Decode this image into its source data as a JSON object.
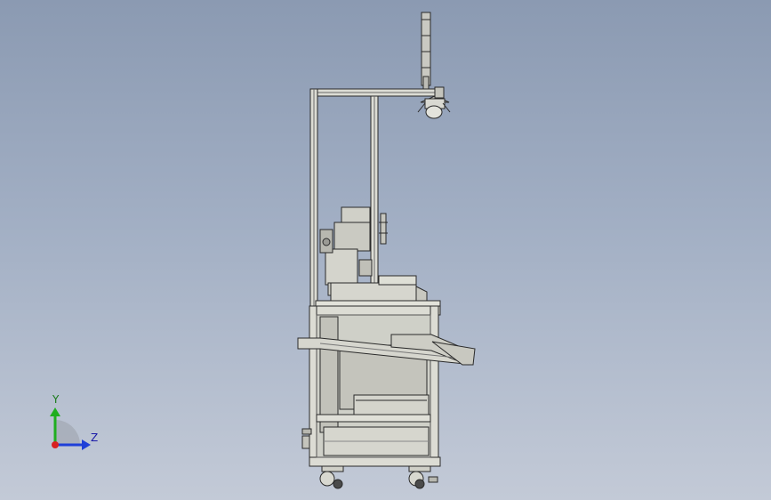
{
  "viewport": {
    "background_top": "#8b9ab2",
    "background_bottom": "#c3cad7"
  },
  "model": {
    "frame_color": "#d8d8d0",
    "edge_color": "#2a2a2a",
    "component_fill": "#c8c8be"
  },
  "triad": {
    "y_label": "Y",
    "z_label": "Z",
    "y_color": "#1fae1f",
    "z_color": "#1f3fd8",
    "origin_color": "#d82020"
  }
}
